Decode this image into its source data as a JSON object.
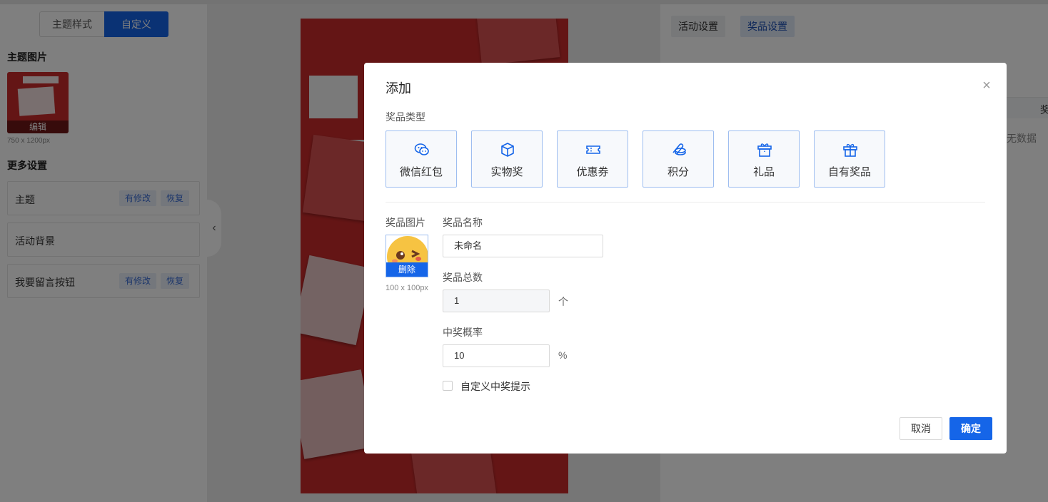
{
  "left_panel": {
    "seg_theme": "主题样式",
    "seg_custom": "自定义",
    "theme_image_title": "主题图片",
    "edit_label": "编辑",
    "image_size": "750 x 1200px",
    "more_settings_title": "更多设置",
    "rows": [
      {
        "label": "主题",
        "modified": "有修改",
        "restore": "恢复"
      },
      {
        "label": "活动背景"
      },
      {
        "label": "我要留言按钮",
        "modified": "有修改",
        "restore": "恢复"
      }
    ]
  },
  "right_panel": {
    "tabs": [
      "活动设置",
      "奖品设置"
    ],
    "table_header_partial": "奖",
    "no_data": "无数据"
  },
  "modal": {
    "title": "添加",
    "prize_type_label": "奖品类型",
    "prize_types": [
      {
        "label": "微信红包",
        "icon": "wechat-icon"
      },
      {
        "label": "实物奖",
        "icon": "box-icon"
      },
      {
        "label": "优惠券",
        "icon": "ticket-icon"
      },
      {
        "label": "积分",
        "icon": "coins-icon"
      },
      {
        "label": "礼品",
        "icon": "gift-box-icon"
      },
      {
        "label": "自有奖品",
        "icon": "gift-icon"
      }
    ],
    "prize_image_label": "奖品图片",
    "image_delete": "删除",
    "image_size": "100 x 100px",
    "prize_name_label": "奖品名称",
    "prize_name_value": "未命名",
    "prize_total_label": "奖品总数",
    "prize_total_value": "1",
    "prize_total_unit": "个",
    "win_rate_label": "中奖概率",
    "win_rate_value": "10",
    "win_rate_unit": "%",
    "custom_tip_label": "自定义中奖提示",
    "cancel": "取消",
    "confirm": "确定"
  },
  "colors": {
    "primary": "#1565e8",
    "poster_red": "#c92b2b"
  }
}
